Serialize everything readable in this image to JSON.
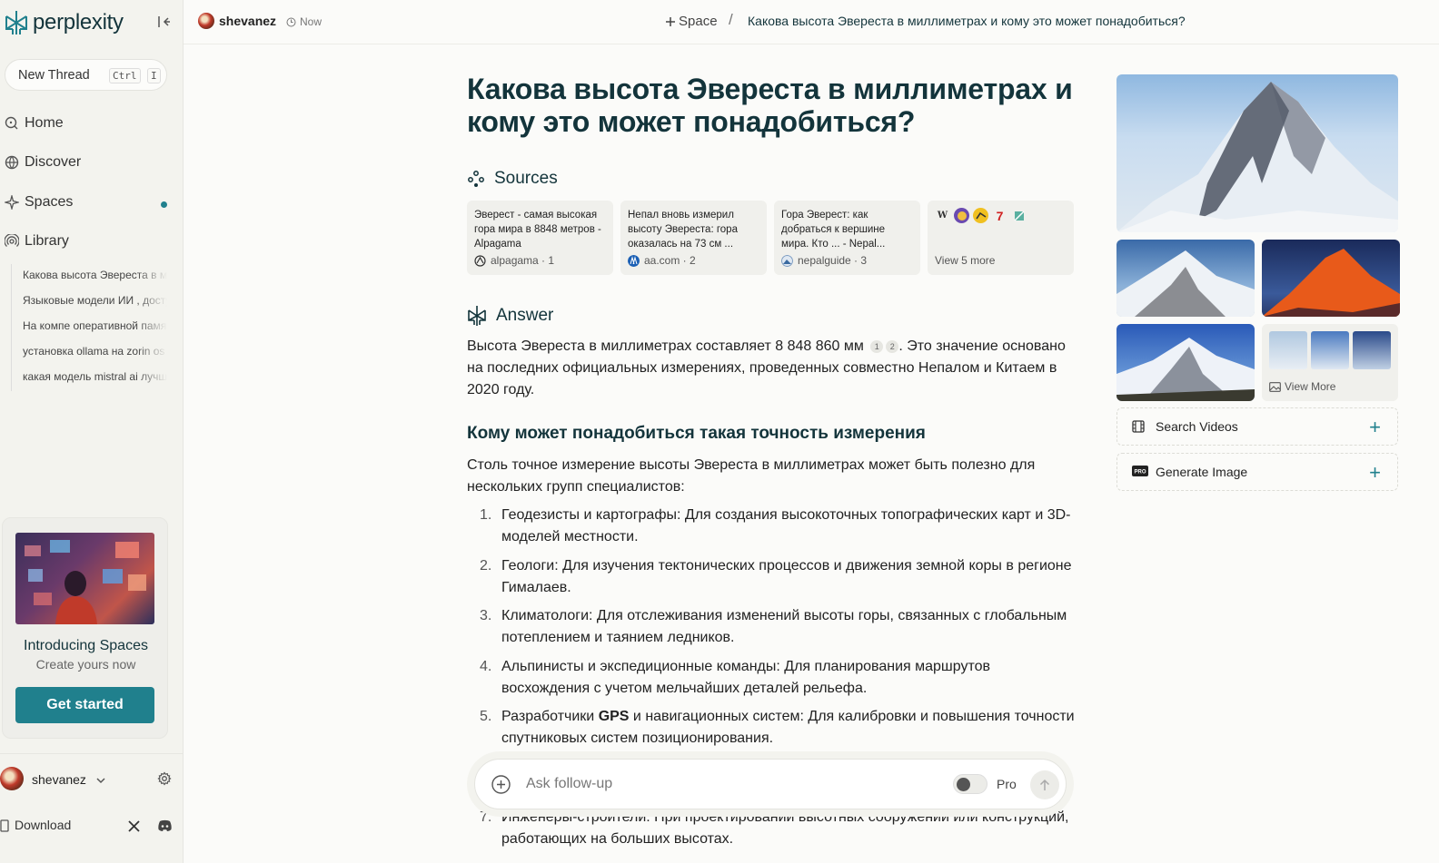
{
  "app": {
    "logo_text": "perplexity",
    "accent_color": "#20808d"
  },
  "sidebar": {
    "new_thread_label": "New Thread",
    "shortcut_key1": "Ctrl",
    "shortcut_key2": "I",
    "nav": [
      {
        "label": "Home"
      },
      {
        "label": "Discover"
      },
      {
        "label": "Spaces"
      },
      {
        "label": "Library"
      }
    ],
    "library_items": [
      "Какова высота Эвереста в миллиметрах",
      "Языковые модели ИИ , доступные",
      "На компе оперативной памяти",
      "установка ollama на zorin os",
      "какая модель mistral ai лучше"
    ],
    "promo": {
      "title": "Introducing Spaces",
      "subtitle": "Create yours now",
      "button": "Get started"
    },
    "user_name": "shevanez",
    "download_label": "Download"
  },
  "header": {
    "user": "shevanez",
    "time": "Now",
    "space_label": "Space",
    "slash": "/",
    "breadcrumb_title": "Какова высота Эвереста в миллиметрах и кому это может понадобиться?"
  },
  "main": {
    "question": "Какова высота Эвереста в миллиметрах и кому это может понадобиться?",
    "sources_heading": "Sources",
    "sources": [
      {
        "title": "Эверест - самая высокая гора мира в 8848 метров - Alpagama",
        "site": "alpagama · 1"
      },
      {
        "title": "Непал вновь измерил высоту Эвереста: гора оказалась на 73 см ...",
        "site": "aa.com · 2"
      },
      {
        "title": "Гора Эверест: как добраться к вершине мира. Кто ... - Nepal...",
        "site": "nepalguide · 3"
      }
    ],
    "view_more_sources": "View 5 more",
    "answer_heading": "Answer",
    "answer_text_1": "Высота Эвереста в миллиметрах составляет 8 848 860 мм",
    "answer_cite_1": "1",
    "answer_cite_2": "2",
    "answer_text_2": ". Это значение основано на последних официальных измерениях, проведенных совместно Непалом и Китаем в 2020 году.",
    "subheading": "Кому может понадобиться такая точность измерения",
    "intro": "Столь точное измерение высоты Эвереста в миллиметрах может быть полезно для нескольких групп специалистов:",
    "list": [
      {
        "num": "1.",
        "text": "Геодезисты и картографы: Для создания высокоточных топографических карт и 3D-моделей местности."
      },
      {
        "num": "2.",
        "text": "Геологи: Для изучения тектонических процессов и движения земной коры в регионе Гималаев."
      },
      {
        "num": "3.",
        "text": "Климатологи: Для отслеживания изменений высоты горы, связанных с глобальным потеплением и таянием ледников."
      },
      {
        "num": "4.",
        "text": "Альпинисты и экспедиционные команды: Для планирования маршрутов восхождения с учетом мельчайших деталей рельефа."
      }
    ],
    "item5_num": "5.",
    "item5_pre": "Разработчики ",
    "item5_bold": "GPS",
    "item5_post": " и навигационных систем: Для калибровки и повышения точности спутниковых систем позиционирования.",
    "item7_num": "7.",
    "item7_text": "Инженеры-строители: При проектировании высотных сооружений или конструкций, работающих на больших высотах.",
    "ask_placeholder": "Ask follow-up",
    "pro_label": "Pro"
  },
  "right": {
    "view_more_images": "View More",
    "search_videos": "Search Videos",
    "generate_image": "Generate Image"
  }
}
